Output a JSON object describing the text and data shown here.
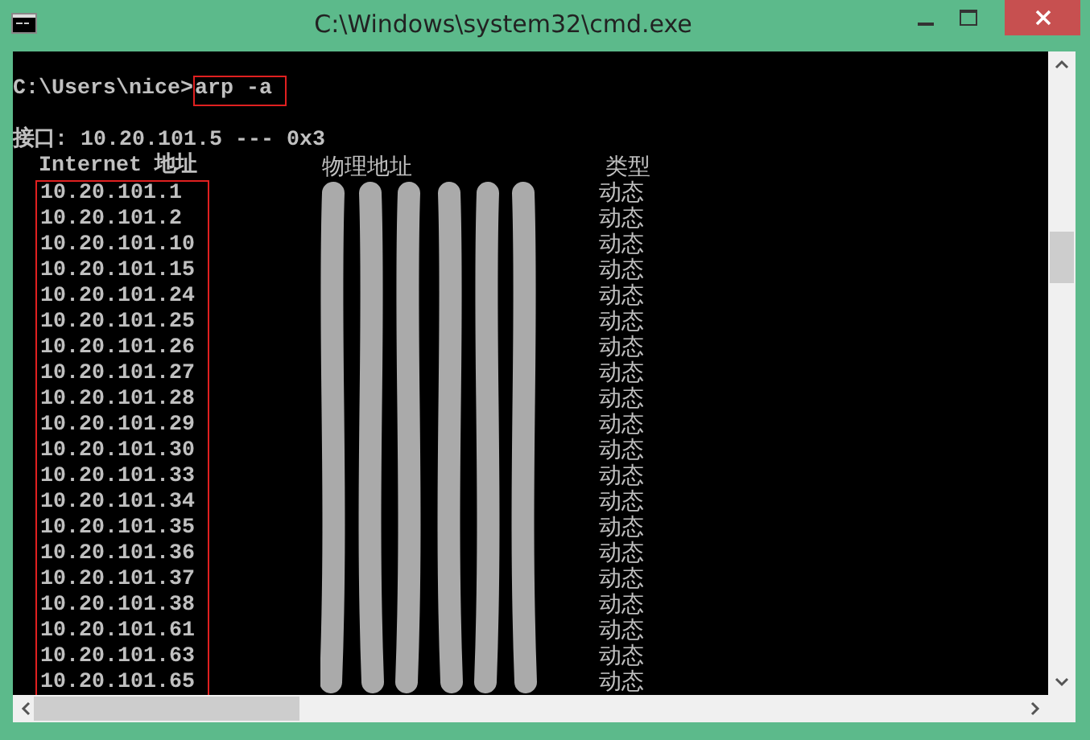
{
  "window": {
    "title": "C:\\Windows\\system32\\cmd.exe"
  },
  "prompt": "C:\\Users\\nice>",
  "command": "arp -a",
  "interface_line": "接口: 10.20.101.5 --- 0x3",
  "columns": [
    "Internet 地址",
    "物理地址",
    "类型"
  ],
  "rows": [
    {
      "ip": "10.20.101.1",
      "type": "动态"
    },
    {
      "ip": "10.20.101.2",
      "type": "动态"
    },
    {
      "ip": "10.20.101.10",
      "type": "动态"
    },
    {
      "ip": "10.20.101.15",
      "type": "动态"
    },
    {
      "ip": "10.20.101.24",
      "type": "动态"
    },
    {
      "ip": "10.20.101.25",
      "type": "动态"
    },
    {
      "ip": "10.20.101.26",
      "type": "动态"
    },
    {
      "ip": "10.20.101.27",
      "type": "动态"
    },
    {
      "ip": "10.20.101.28",
      "type": "动态"
    },
    {
      "ip": "10.20.101.29",
      "type": "动态"
    },
    {
      "ip": "10.20.101.30",
      "type": "动态"
    },
    {
      "ip": "10.20.101.33",
      "type": "动态"
    },
    {
      "ip": "10.20.101.34",
      "type": "动态"
    },
    {
      "ip": "10.20.101.35",
      "type": "动态"
    },
    {
      "ip": "10.20.101.36",
      "type": "动态"
    },
    {
      "ip": "10.20.101.37",
      "type": "动态"
    },
    {
      "ip": "10.20.101.38",
      "type": "动态"
    },
    {
      "ip": "10.20.101.61",
      "type": "动态"
    },
    {
      "ip": "10.20.101.63",
      "type": "动态"
    },
    {
      "ip": "10.20.101.65",
      "type": "动态"
    }
  ]
}
